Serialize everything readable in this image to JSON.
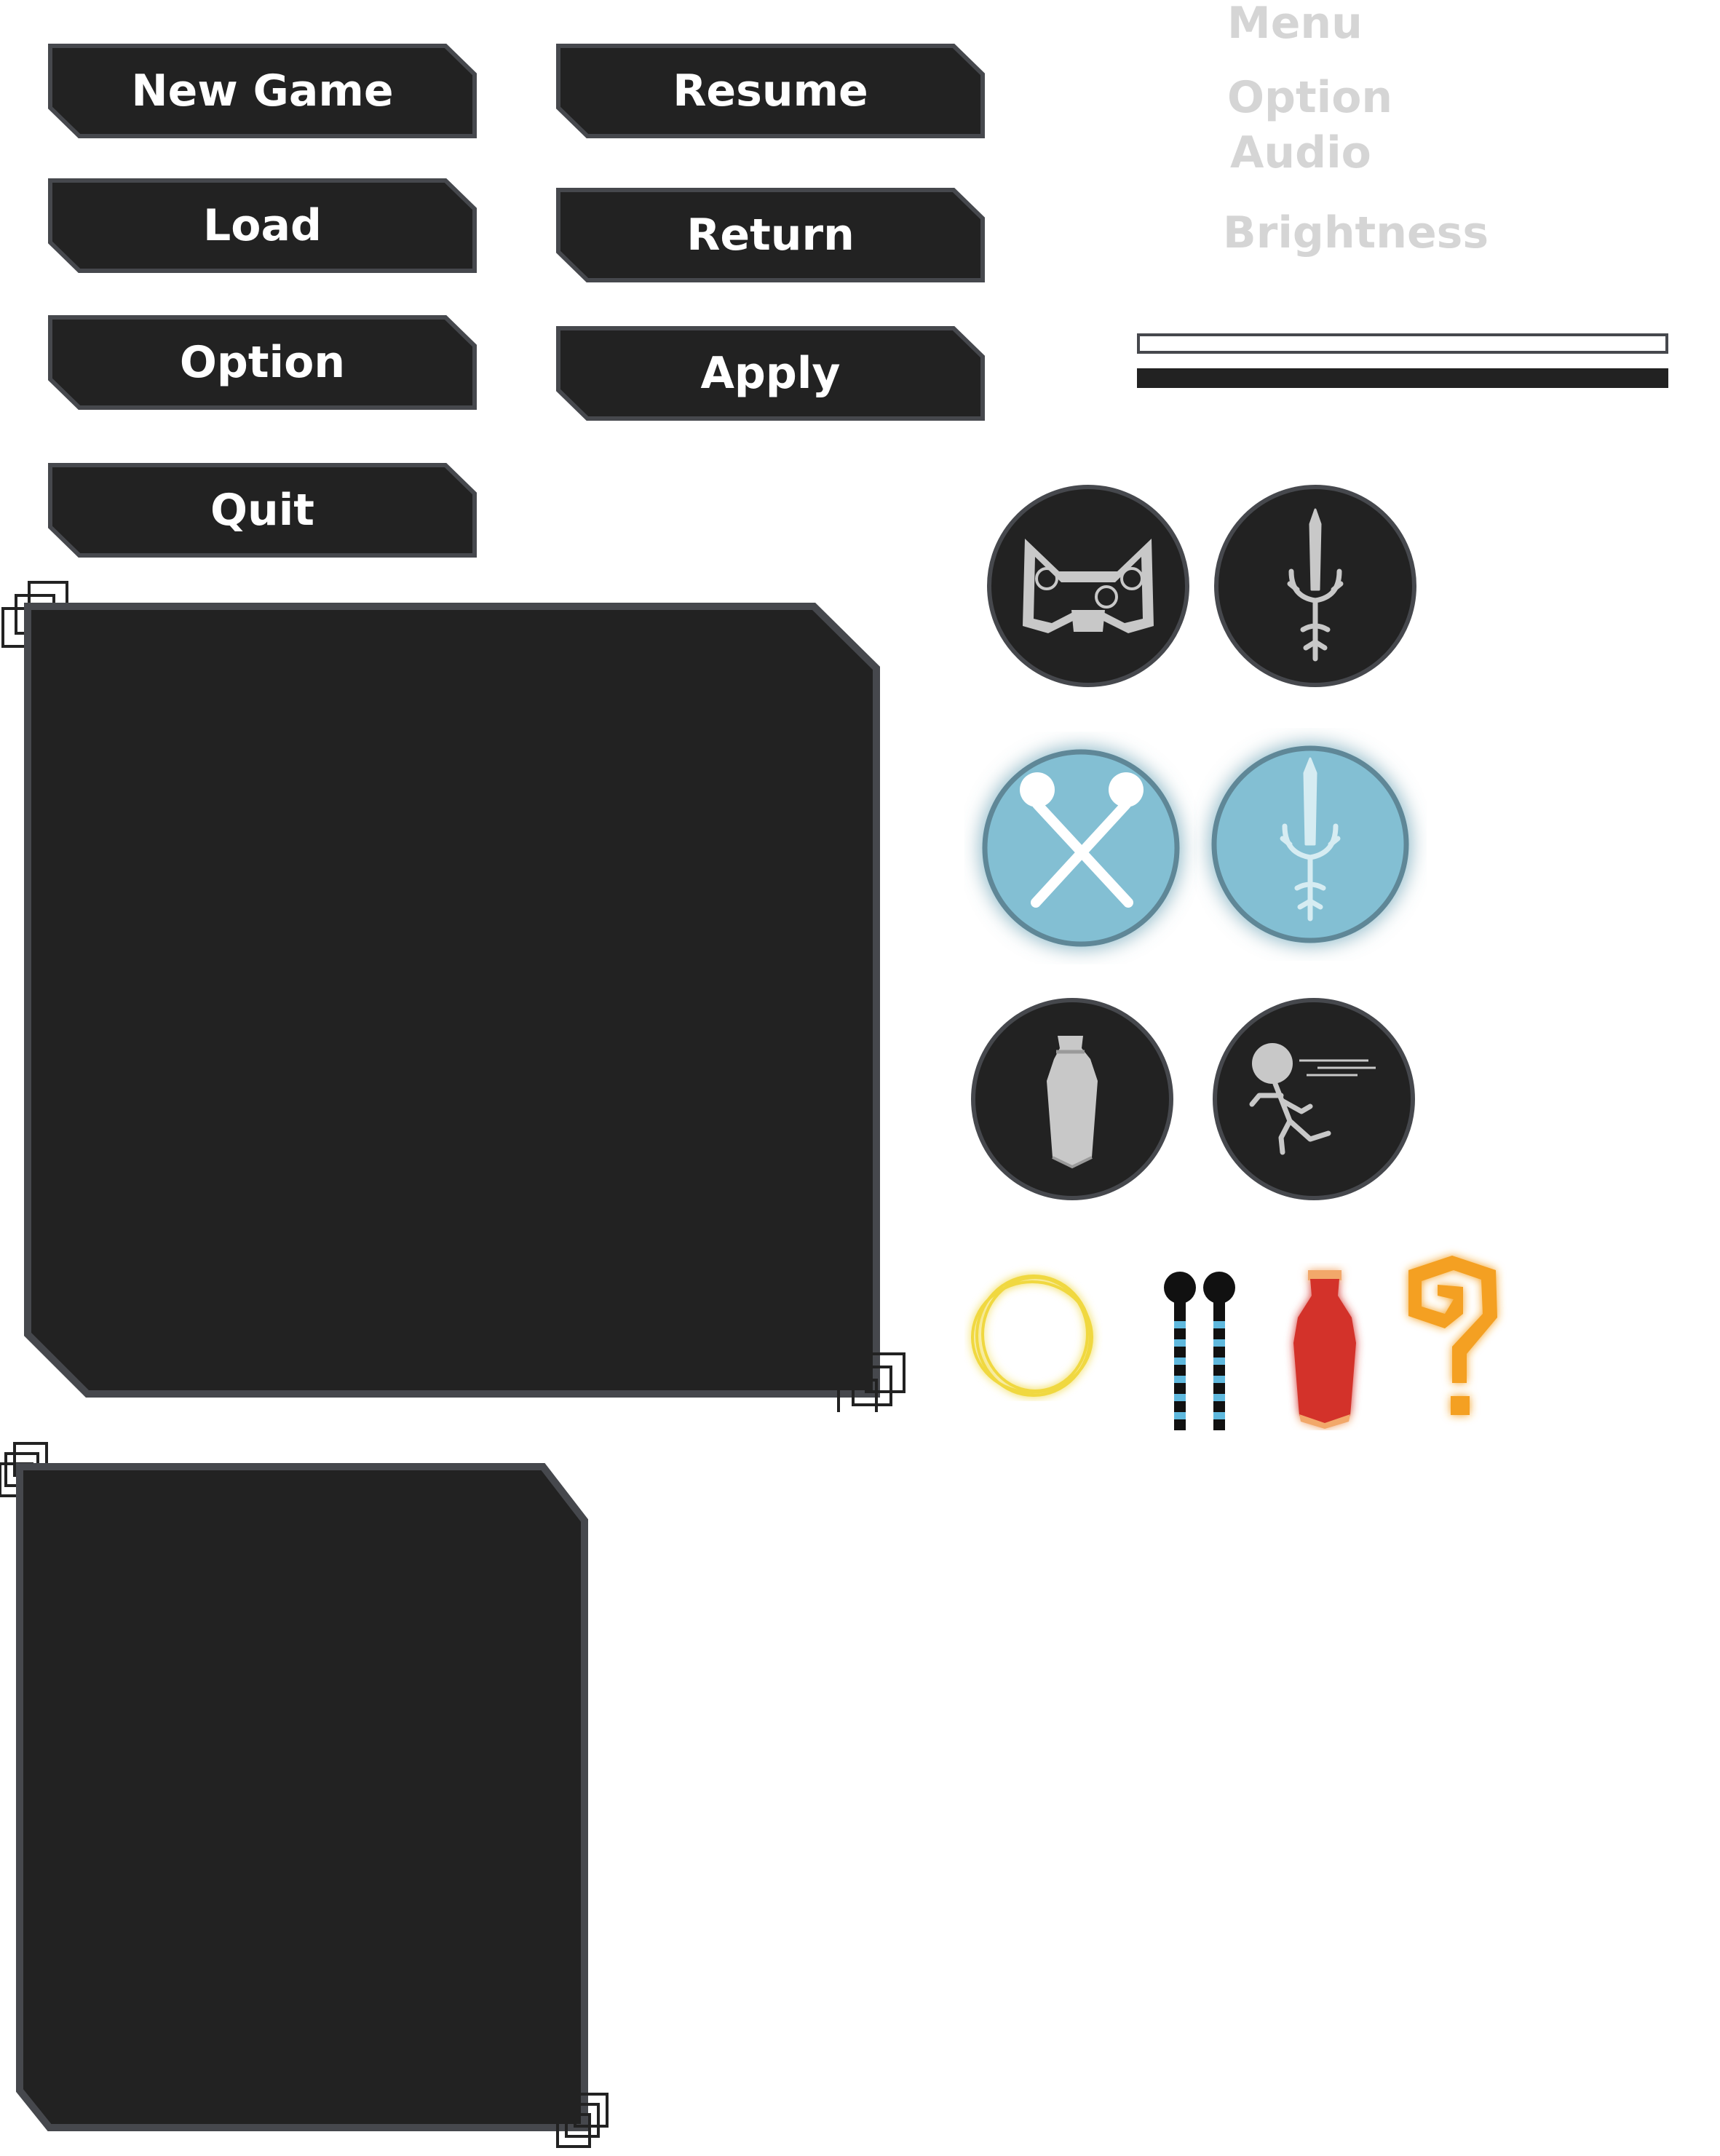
{
  "main_menu": {
    "new_game": "New Game",
    "load": "Load",
    "option": "Option",
    "quit": "Quit"
  },
  "pause_menu": {
    "resume": "Resume",
    "return": "Return",
    "apply": "Apply"
  },
  "option_labels": {
    "menu": "Menu",
    "option": "Option",
    "audio": "Audio",
    "brightness": "Brightness"
  },
  "colors": {
    "button_fill": "#222222",
    "button_border": "#46484d",
    "label_text": "#d5d5d5",
    "ability_glow": "#83bfd3",
    "ring_gold": "#f0d840",
    "potion_red": "#d3312c",
    "question_orange": "#f4a020"
  },
  "icons": {
    "ability_slots": [
      "mask-icon",
      "trident-sword-icon",
      "crossed-sticks-icon-active",
      "trident-sword-icon-active",
      "potion-bottle-icon",
      "dash-runner-icon"
    ],
    "items": [
      "gold-ring-icon",
      "drumsticks-icon",
      "red-potion-icon",
      "question-mark-icon"
    ]
  }
}
